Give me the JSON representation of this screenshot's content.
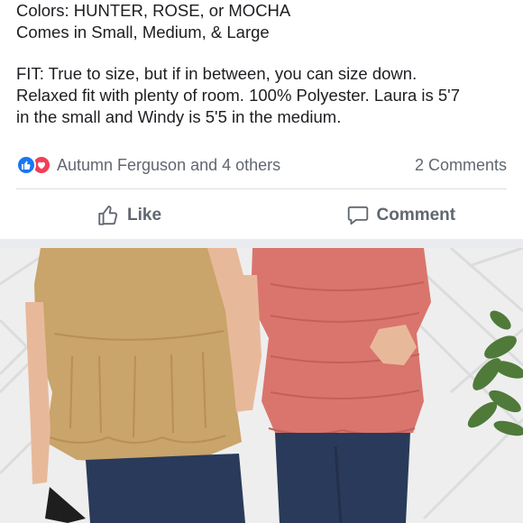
{
  "post": {
    "lines": [
      "Colors: HUNTER, ROSE, or MOCHA",
      "Comes in Small, Medium, & Large",
      "FIT: True to size, but if in between, you can size down.",
      "Relaxed fit with plenty of room. 100% Polyester. Laura is 5'7",
      "in the small and Windy is 5'5 in the medium."
    ]
  },
  "reactions": {
    "icons": [
      "like-reaction-icon",
      "love-reaction-icon"
    ],
    "summary": "Autumn Ferguson and 4 others",
    "comments_count": "2 Comments"
  },
  "actions": {
    "like_label": "Like",
    "comment_label": "Comment"
  },
  "colors": {
    "like_blue": "#1877f2",
    "love_red": "#f33e58",
    "secondary_text": "#606770",
    "mocha_top": "#c9a46b",
    "rose_top": "#d9756d",
    "jeans": "#2a3a5a"
  }
}
